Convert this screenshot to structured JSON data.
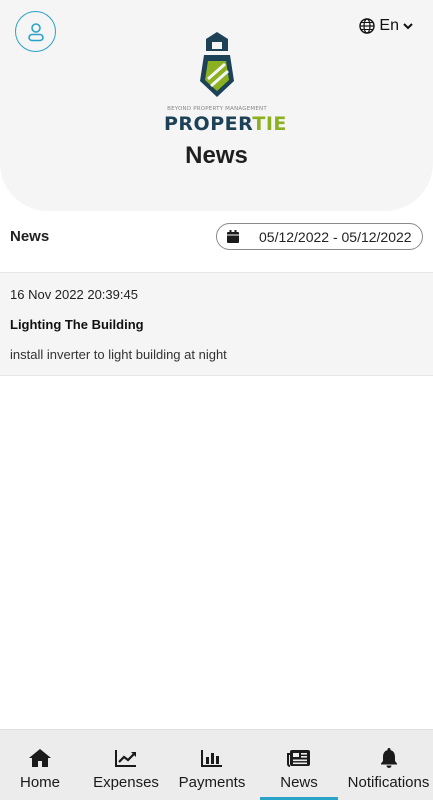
{
  "header": {
    "language": "En",
    "logo": {
      "tagline": "BEYOND PROPERTY MANAGEMENT",
      "word_primary": "PROPER",
      "word_accent": "TIE"
    },
    "title": "News"
  },
  "news_section": {
    "title": "News",
    "date_range": "05/12/2022 - 05/12/2022",
    "items": [
      {
        "date": "16 Nov 2022 20:39:45",
        "title": "Lighting The Building",
        "body": "install inverter to light building at night"
      }
    ]
  },
  "bottom_nav": {
    "items": [
      {
        "label": "Home",
        "icon": "home-icon"
      },
      {
        "label": "Expenses",
        "icon": "chart-line-icon"
      },
      {
        "label": "Payments",
        "icon": "bar-chart-icon"
      },
      {
        "label": "News",
        "icon": "newspaper-icon",
        "active": true
      },
      {
        "label": "Notifications",
        "icon": "bell-icon"
      }
    ]
  },
  "colors": {
    "accent": "#2aa3c9",
    "brand_dark": "#1d4258",
    "brand_green": "#8bb020",
    "header_bg": "#f5f5f5",
    "nav_bg": "#ececec"
  }
}
